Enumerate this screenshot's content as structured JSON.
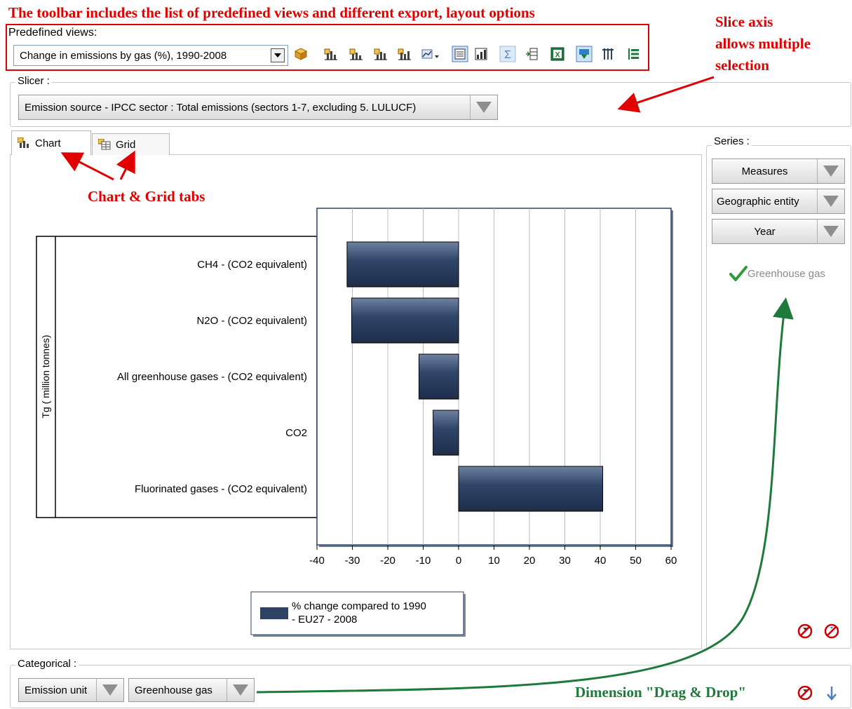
{
  "annotations": {
    "toolbar_note": "The toolbar includes the list of predefined views and different export, layout options",
    "slice_note": [
      "Slice axis",
      "allows multiple",
      "selection"
    ],
    "tabs_note": "Chart & Grid tabs",
    "dragdrop_note": "Dimension \"Drag & Drop\""
  },
  "toolbar": {
    "predefined_label": "Predefined views:",
    "selected_view": "Change in emissions by gas (%), 1990-2008",
    "icons": [
      "cube-icon",
      "bar-chart-icon",
      "bar-chart-icon-2",
      "bar-chart-icon-3",
      "bar-chart-icon-4",
      "chart-options-icon",
      "list-view-icon",
      "chart-type-icon",
      "sum-icon",
      "pivot-icon",
      "excel-icon",
      "filter-icon",
      "columns-icon",
      "rows-icon"
    ]
  },
  "slicer": {
    "label": "Slicer :",
    "value": "Emission source - IPCC sector : Total emissions (sectors 1-7, excluding 5. LULUCF)"
  },
  "tabs": [
    {
      "label": "Chart"
    },
    {
      "label": "Grid"
    }
  ],
  "series_panel": {
    "label": "Series :",
    "buttons": [
      "Measures",
      "Geographic entity",
      "Year"
    ],
    "greenhouse_label": "Greenhouse gas"
  },
  "categorical": {
    "label": "Categorical :",
    "buttons": [
      "Emission unit",
      "Greenhouse gas"
    ]
  },
  "colors": {
    "bar": "#2e4263",
    "annotation_red": "#e00000",
    "annotation_green": "#1e7a3c"
  },
  "chart_data": {
    "type": "bar",
    "orientation": "horizontal",
    "categories": [
      "CH4 - (CO2 equivalent)",
      "N2O - (CO2 equivalent)",
      "All greenhouse gases - (CO2 equivalent)",
      "CO2",
      "Fluorinated gases - (CO2 equivalent)"
    ],
    "series": [
      {
        "name": "% change compared to 1990 - EU27 - 2008",
        "values": [
          -31.5,
          -30.2,
          -11.2,
          -7.2,
          40.7
        ]
      }
    ],
    "ylabel": "Tg ( million tonnes)",
    "xlim": [
      -40,
      60
    ],
    "xticks": [
      -40,
      -30,
      -20,
      -10,
      0,
      10,
      20,
      30,
      40,
      50,
      60
    ],
    "grid": true,
    "legend_lines": [
      "% change compared to 1990",
      "- EU27 - 2008"
    ]
  }
}
